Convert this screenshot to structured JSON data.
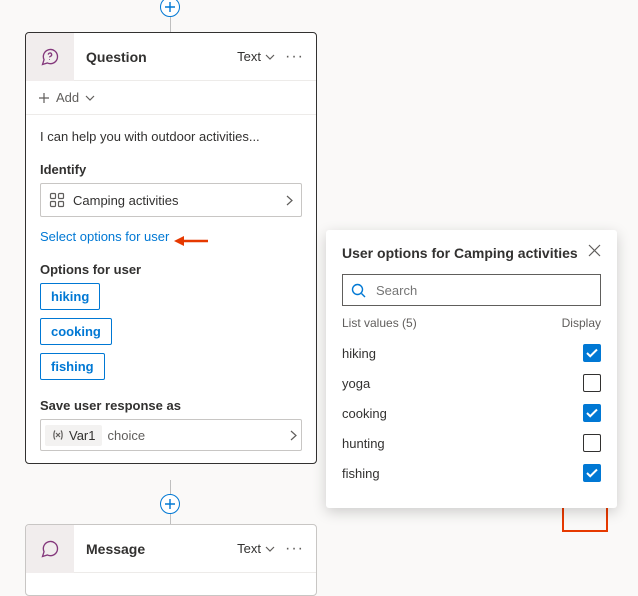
{
  "question_card": {
    "title": "Question",
    "type_label": "Text",
    "add_label": "Add",
    "prompt": "I can help you with outdoor activities...",
    "identify_label": "Identify",
    "identify_value": "Camping activities",
    "select_link": "Select options for user",
    "options_label": "Options for user",
    "chips": [
      "hiking",
      "cooking",
      "fishing"
    ],
    "save_label": "Save user response as",
    "var_name": "Var1",
    "var_type": "choice"
  },
  "message_card": {
    "title": "Message",
    "type_label": "Text"
  },
  "popup": {
    "title": "User options for Camping activities",
    "search_placeholder": "Search",
    "list_header": "List values (5)",
    "display_header": "Display",
    "options": [
      {
        "label": "hiking",
        "checked": true
      },
      {
        "label": "yoga",
        "checked": false
      },
      {
        "label": "cooking",
        "checked": true
      },
      {
        "label": "hunting",
        "checked": false
      },
      {
        "label": "fishing",
        "checked": true
      }
    ]
  }
}
